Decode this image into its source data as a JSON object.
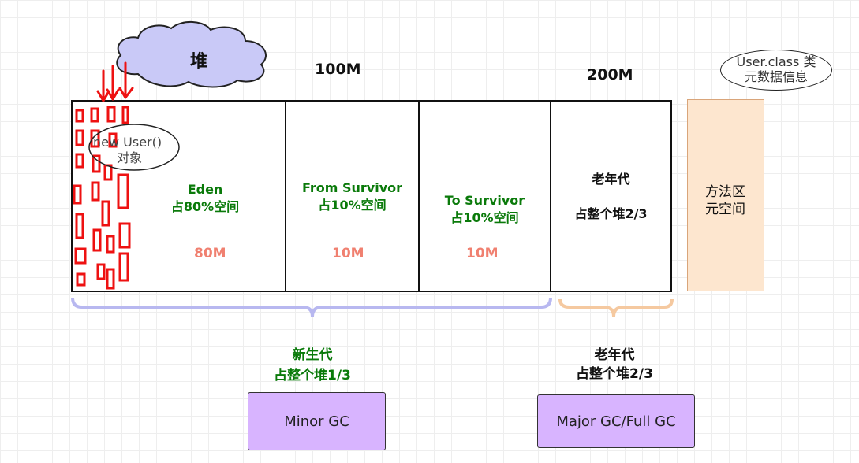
{
  "heap_cloud": {
    "label": "堆"
  },
  "top_sizes": {
    "young": "100M",
    "old": "200M"
  },
  "metaspace_note": {
    "line1": "User.class 类",
    "line2": "元数据信息"
  },
  "new_object": {
    "line1": "new User()",
    "line2": "对象"
  },
  "eden": {
    "name": "Eden",
    "ratio": "占80%空间",
    "size": "80M"
  },
  "from_survivor": {
    "name": "From Survivor",
    "ratio": "占10%空间",
    "size": "10M"
  },
  "to_survivor": {
    "name": "To Survivor",
    "ratio": "占10%空间",
    "size": "10M"
  },
  "old_gen": {
    "name": "老年代",
    "ratio": "占整个堆2/3"
  },
  "method_area": {
    "line1": "方法区",
    "line2": "元空间"
  },
  "young_brace": {
    "line1": "新生代",
    "line2": "占整个堆1/3"
  },
  "old_brace": {
    "line1": "老年代",
    "line2": "占整个堆2/3"
  },
  "buttons": {
    "minor_gc": "Minor GC",
    "major_gc": "Major GC/Full GC"
  },
  "colors": {
    "green_text": "#0a7a0a",
    "size_text": "#f08070",
    "young_brace": "#b8b8f0",
    "old_brace": "#f5c9a0",
    "method_area_fill": "#fde6cf",
    "gc_button_fill": "#d8b4ff",
    "cloud_fill": "#c9c9f7",
    "annotation_red": "#ee1111"
  }
}
